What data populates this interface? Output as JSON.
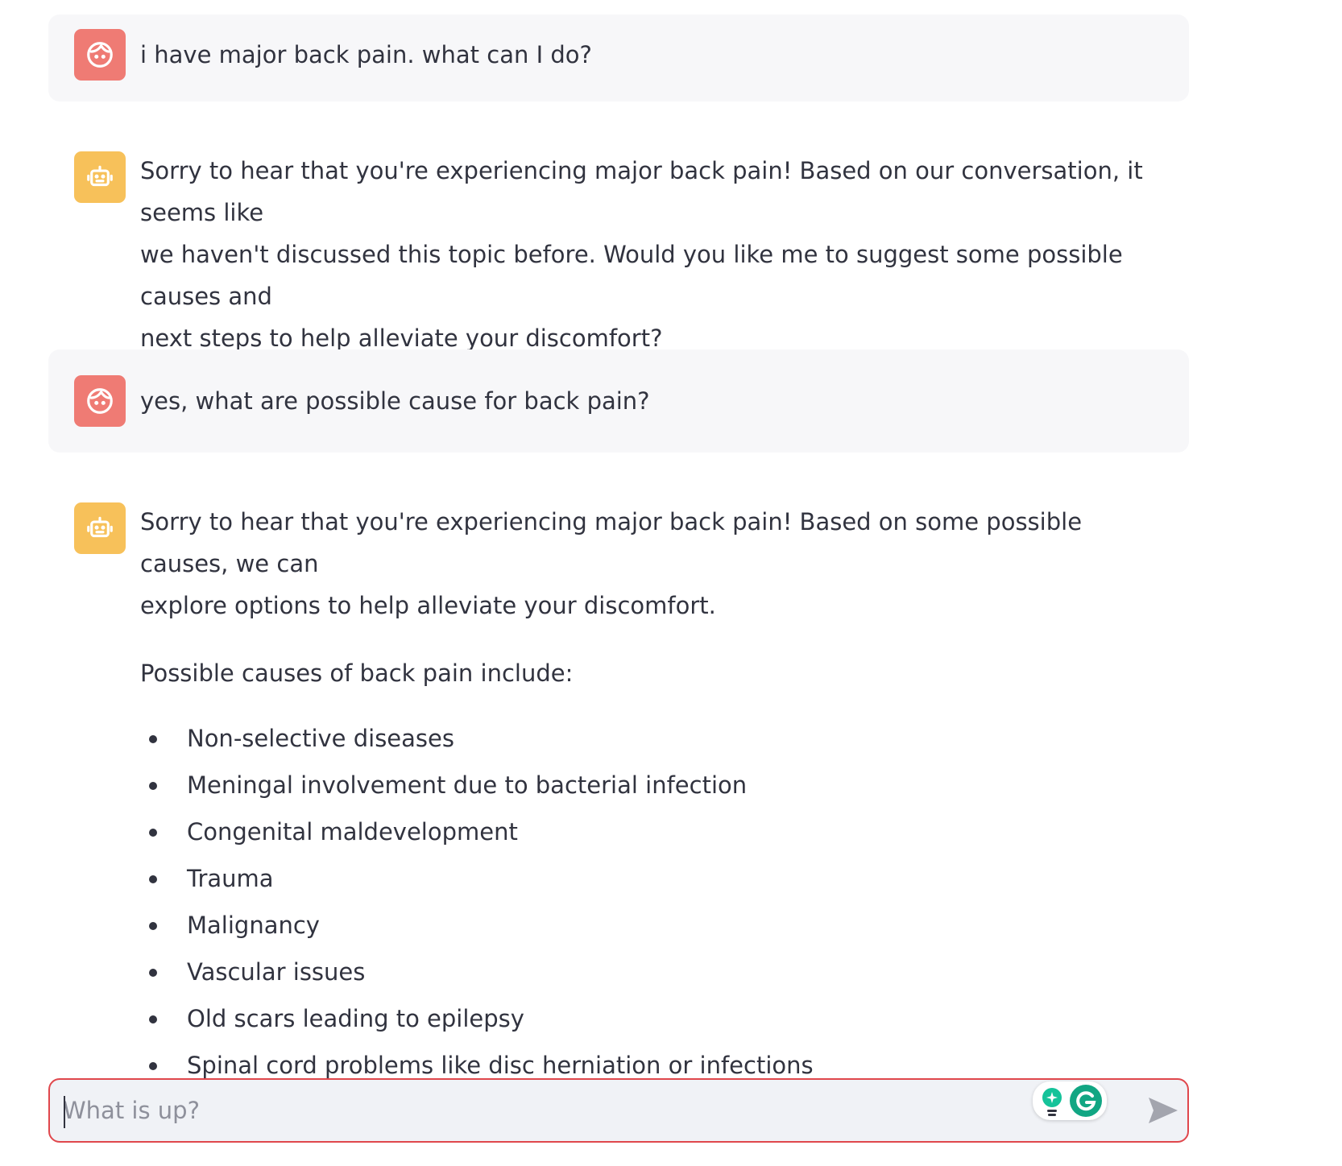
{
  "messages": [
    {
      "role": "user",
      "text": "i have major back pain. what can I do?"
    },
    {
      "role": "assistant",
      "lines": [
        "Sorry to hear that you're experiencing major back pain! Based on our conversation, it seems like",
        "we haven't discussed this topic before. Would you like me to suggest some possible causes and",
        "next steps to help alleviate your discomfort?"
      ]
    },
    {
      "role": "user",
      "text": "yes, what are possible cause for back pain?"
    },
    {
      "role": "assistant",
      "lines": [
        "Sorry to hear that you're experiencing major back pain! Based on some possible causes, we can",
        "explore options to help alleviate your discomfort."
      ],
      "list_intro": "Possible causes of back pain include:",
      "list": [
        "Non-selective diseases",
        "Meningal involvement due to bacterial infection",
        "Congenital maldevelopment",
        "Trauma",
        "Malignancy",
        "Vascular issues",
        "Old scars leading to epilepsy",
        "Spinal cord problems like disc herniation or infections"
      ]
    }
  ],
  "chat_input": {
    "placeholder": "What is up?",
    "value": ""
  },
  "icons": {
    "user_avatar": "user-face-icon",
    "assistant_avatar": "robot-icon",
    "send": "send-arrow-icon",
    "extension_1": "lightbulb-icon",
    "extension_2": "grammarly-icon"
  },
  "colors": {
    "user_avatar_bg": "#ef7b74",
    "assistant_avatar_bg": "#f7c15a",
    "user_message_bg": "#f7f7f9",
    "input_border": "#e0474c",
    "input_bg": "#f0f2f6",
    "text": "#31333f"
  }
}
